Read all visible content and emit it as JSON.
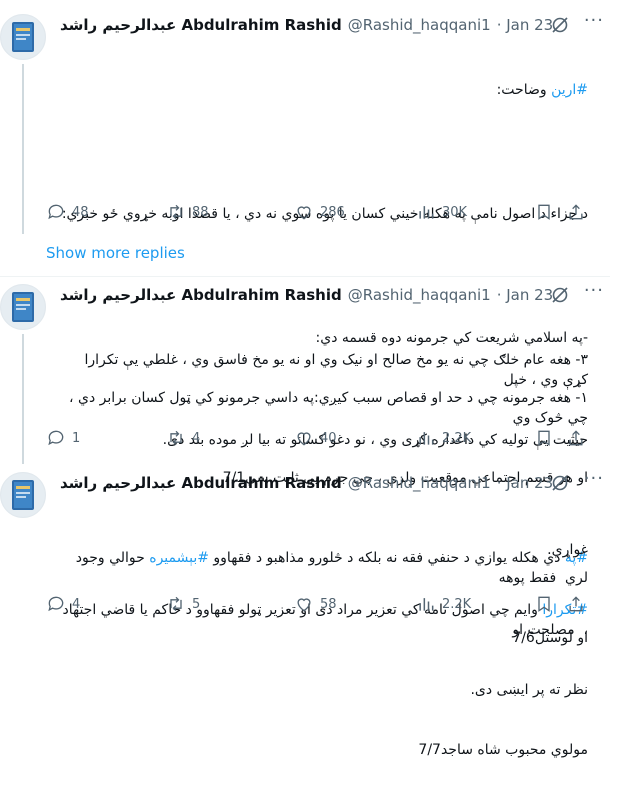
{
  "author": {
    "display_name": "عبدالرحيم راشد Abdulrahim Rashid",
    "handle": "@Rashid_haqqani1"
  },
  "tweets": [
    {
      "date": "· Jan 23",
      "tag1": "#ارین",
      "text_after_tag1": " وضاحت:",
      "line2": "د جزاء د اصول نامې په هکله خيني کسان يا پوه سوي نه دي ، يا قصدا اوبه خړوي ځو خبري:",
      "line3": "-په اسلامي شريعت کي جرمونه دوه قسمه دي:",
      "line4": "۱- هغه جرمونه چي د حد او قصاص سبب کيږي:په داسي جرمونو کي ټول کسان برابر دي ، چي څوک وي",
      "line5": "او هر قسم اجتماعي موقعيت ولري ، چي جرم يې ثابت سي7/1",
      "replies": "48",
      "reposts": "88",
      "likes": "286",
      "views": "30K"
    },
    {
      "date": "· Jan 23",
      "line1": "۳- هغه عام خلګ چي نه يو مخ صالح او نيک وي او نه يو مخ فاسق وي ، غلطي يې تکرارا کړې وي ، خپل",
      "line2": "حيثيت يې توليه کي داغداره کړی وي ، نو دغو کسانو ته بيا لږ موده بند دی.",
      "tag1": "#په",
      "text_mid": " دي هکله يوازي د حنفي فقه نه بلکه د څلورو مذاهبو د فقهاوو ",
      "tag2": "#بېشميره",
      "text_end": " حوالي وجود لري  فقط پوهه",
      "line4": "او لوستل7/6",
      "replies": "1",
      "reposts": "4",
      "likes": "40",
      "views": "2.2K"
    },
    {
      "date": "· Jan 23",
      "line1": "غواړي.",
      "tag1": "#تکرارا",
      "text_after_tag1": " وايم چي اصول نامه کي تعزير مراد دی او تعزير ټولو فقهاوو د حاکم يا قاضي اجتهاد ،  مصلحت او",
      "line3": "نظر ته پر ايښی دی.",
      "line4": "مولوي محبوب شاه ساجد7/7",
      "replies": "4",
      "reposts": "5",
      "likes": "58",
      "views": "2.2K"
    }
  ],
  "show_more": "Show more replies",
  "colors": {
    "link": "#1d9bf0",
    "muted": "#536471",
    "thread_line": "#cfd9de"
  }
}
